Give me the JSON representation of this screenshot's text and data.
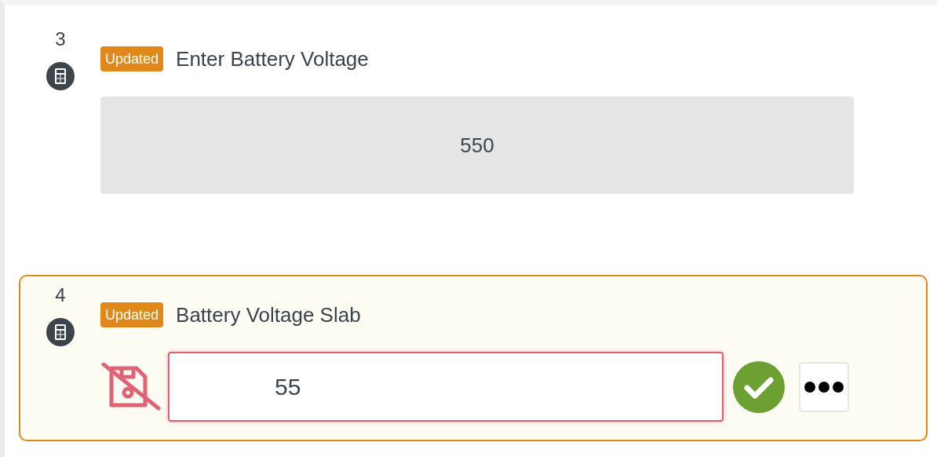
{
  "steps": [
    {
      "number": "3",
      "badge": "Updated",
      "title": "Enter Battery Voltage",
      "kind": "readonly",
      "value": "550",
      "selected": false
    },
    {
      "number": "4",
      "badge": "Updated",
      "title": "Battery Voltage Slab",
      "kind": "edit",
      "value": "55",
      "selected": true,
      "invalid": true
    }
  ]
}
